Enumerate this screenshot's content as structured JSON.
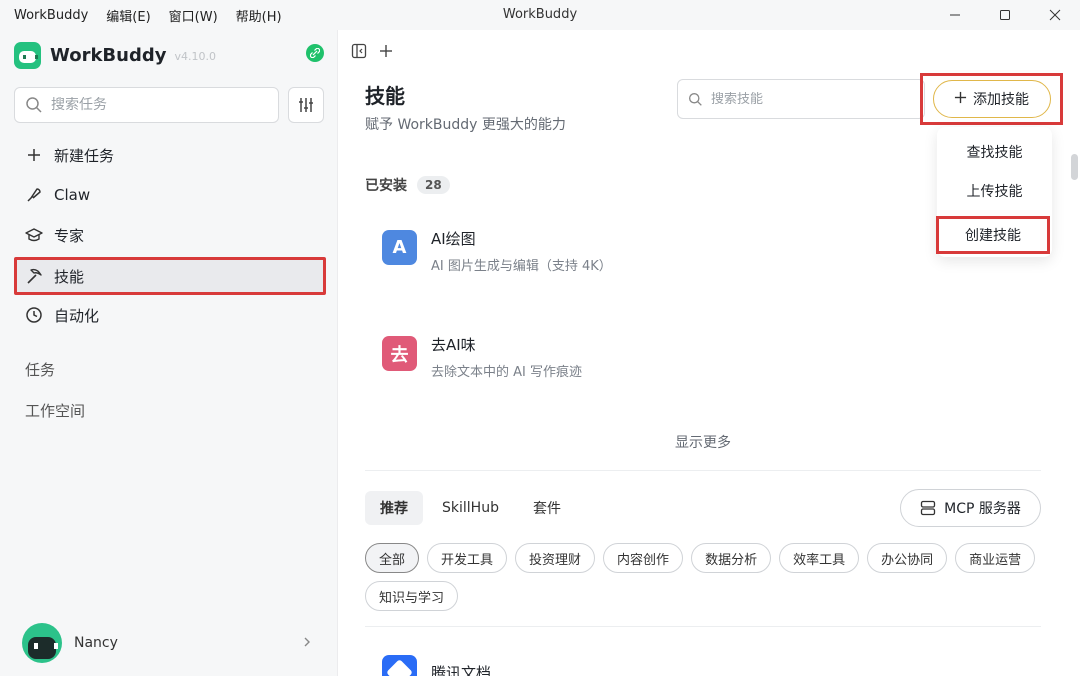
{
  "titlebar": {
    "menus": [
      "WorkBuddy",
      "编辑(E)",
      "窗口(W)",
      "帮助(H)"
    ],
    "title": "WorkBuddy"
  },
  "sidebar": {
    "brand": "WorkBuddy",
    "version": "v4.10.0",
    "search_placeholder": "搜索任务",
    "nav": [
      {
        "label": "新建任务",
        "icon": "plus-icon"
      },
      {
        "label": "Claw",
        "icon": "claw-icon"
      },
      {
        "label": "专家",
        "icon": "graduation-cap-icon"
      },
      {
        "label": "技能",
        "icon": "pickaxe-icon"
      },
      {
        "label": "自动化",
        "icon": "clock-icon"
      }
    ],
    "sections": [
      "任务",
      "工作空间"
    ],
    "user": "Nancy"
  },
  "main": {
    "title": "技能",
    "subtitle": "赋予 WorkBuddy 更强大的能力",
    "search_placeholder": "搜索技能",
    "add_label": "添加技能",
    "dropdown": [
      "查找技能",
      "上传技能",
      "创建技能"
    ],
    "installed_label": "已安装",
    "installed_count": "28",
    "skills": [
      {
        "icon_text": "A",
        "name": "AI绘图",
        "desc": "AI 图片生成与编辑（支持 4K）",
        "color": "#4e88e0"
      },
      {
        "icon_text": "去",
        "name": "去AI味",
        "desc": "去除文本中的 AI 写作痕迹",
        "color": "#e05a78"
      }
    ],
    "show_more": "显示更多",
    "tabs": [
      "推荐",
      "SkillHub",
      "套件"
    ],
    "mcp_label": "MCP 服务器",
    "chips": [
      "全部",
      "开发工具",
      "投资理财",
      "内容创作",
      "数据分析",
      "效率工具",
      "办公协同",
      "商业运营",
      "知识与学习"
    ],
    "bottom_skill": "腾讯文档"
  }
}
